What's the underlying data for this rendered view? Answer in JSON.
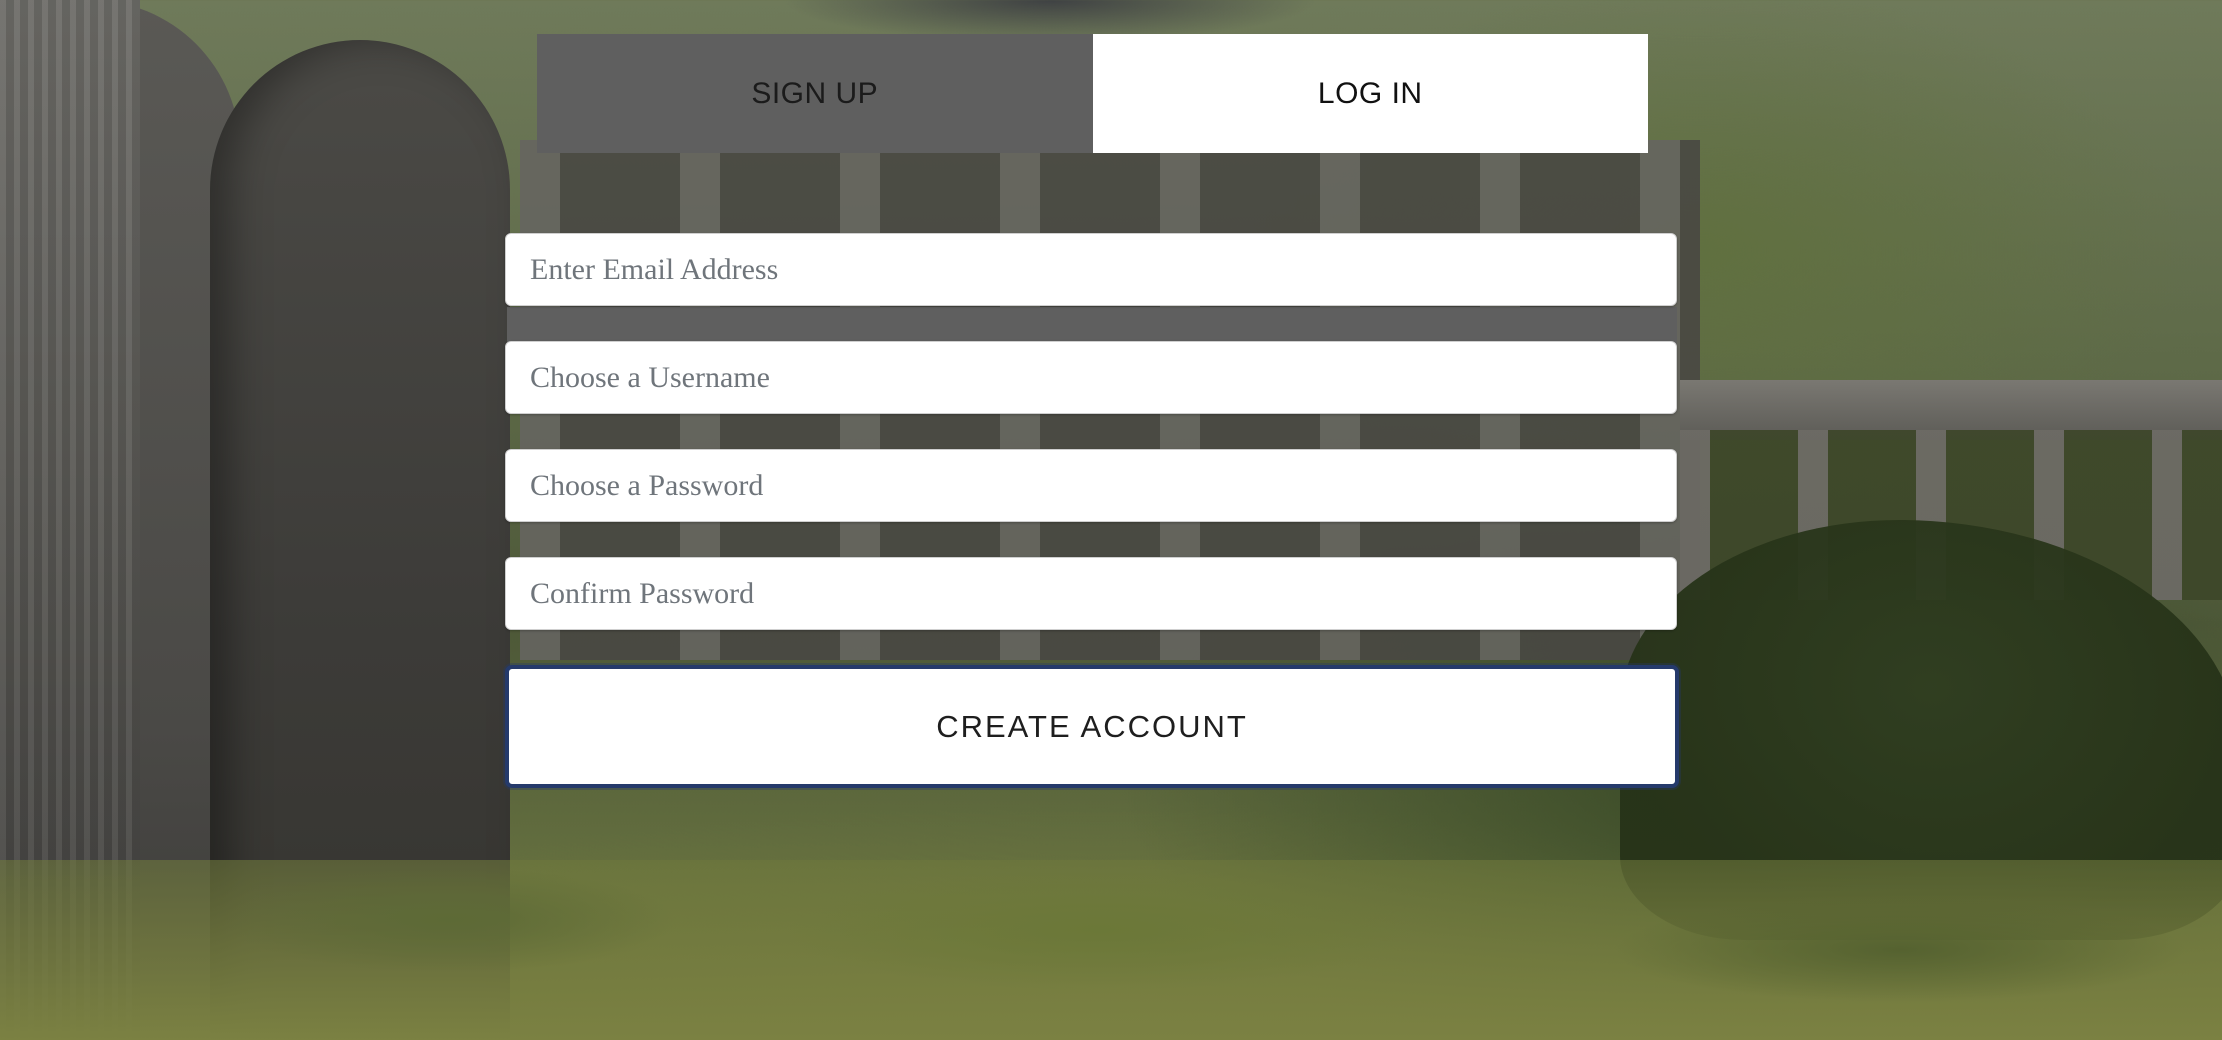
{
  "tabs": [
    {
      "label": "SIGN UP"
    },
    {
      "label": "LOG IN"
    }
  ],
  "form": {
    "email": {
      "placeholder": "Enter Email Address",
      "value": ""
    },
    "username": {
      "placeholder": "Choose a Username",
      "value": ""
    },
    "password": {
      "placeholder": "Choose a Password",
      "value": ""
    },
    "confirm_password": {
      "placeholder": "Confirm Password",
      "value": ""
    },
    "submit_label": "CREATE ACCOUNT"
  },
  "colors": {
    "inactive_tab": "#5f5f5f",
    "active_tab": "#ffffff",
    "button_border": "#253a6b"
  }
}
